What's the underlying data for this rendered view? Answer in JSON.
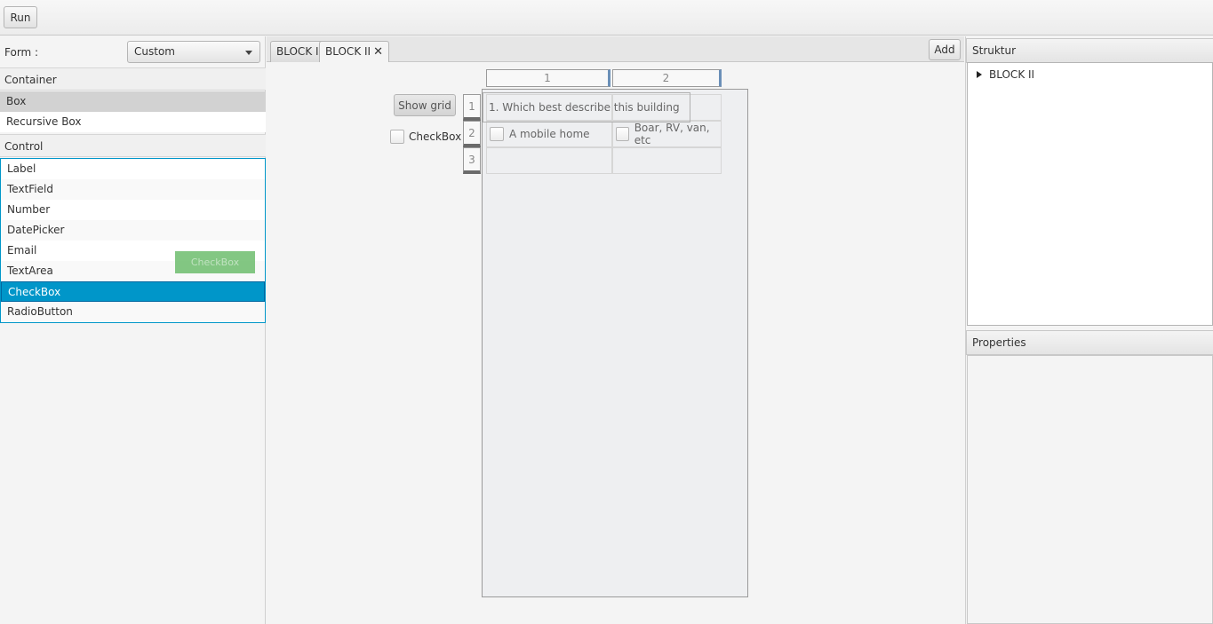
{
  "toolbar": {
    "run_label": "Run"
  },
  "left": {
    "form_label": "Form :",
    "form_value": "Custom",
    "container_header": "Container",
    "container_items": [
      "Box",
      "Recursive Box"
    ],
    "control_header": "Control",
    "control_items": [
      "Label",
      "TextField",
      "Number",
      "DatePicker",
      "Email",
      "TextArea",
      "CheckBox",
      "RadioButton"
    ],
    "drag_ghost_label": "CheckBox"
  },
  "center": {
    "tabs": [
      {
        "label": "BLOCK I"
      },
      {
        "label": "BLOCK II",
        "close": "✕"
      }
    ],
    "add_label": "Add",
    "show_grid_label": "Show grid",
    "checkbox_label": "CheckBox",
    "grid": {
      "col_headers": [
        "1",
        "2"
      ],
      "row_headers": [
        "1",
        "2",
        "3"
      ],
      "question": "1. Which best describe this building",
      "option_1": "A mobile home",
      "option_2": "Boar, RV, van, etc"
    }
  },
  "right": {
    "struktur_header": "Struktur",
    "tree_item": "BLOCK II",
    "properties_header": "Properties"
  }
}
